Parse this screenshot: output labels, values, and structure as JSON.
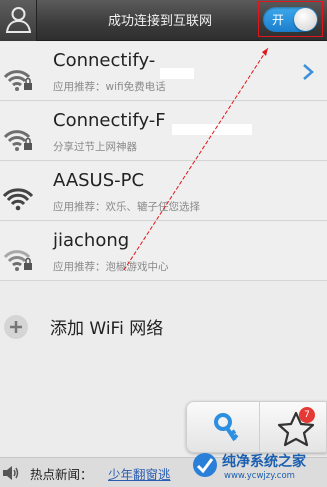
{
  "header": {
    "title": "成功连接到互联网",
    "avatar_icon": "user-icon",
    "toggle_label": "开",
    "toggle_state": "on",
    "accent_color": "#2a8fdc"
  },
  "networks": [
    {
      "name": "Connectify-",
      "subtitle": "应用推荐：wifi免费电话",
      "signal_icon": "wifi-locked-icon",
      "selected": true
    },
    {
      "name": "Connectify-F",
      "subtitle": "分享过节上网神器",
      "signal_icon": "wifi-locked-icon"
    },
    {
      "name": "AASUS-PC",
      "subtitle": "应用推荐：欢乐、辘子任您选择",
      "signal_icon": "wifi-icon"
    },
    {
      "name": "jiachong",
      "subtitle": "应用推荐：泡椒游戏中心",
      "signal_icon": "wifi-locked-icon"
    }
  ],
  "add_wifi": {
    "label": "添加 WiFi 网络",
    "icon": "plus-icon"
  },
  "floating_panel": {
    "key_icon": "key-icon",
    "star_icon": "star-icon",
    "badge_count": "7"
  },
  "news": {
    "label": "热点新闻：",
    "link_text": "少年翻窗逃",
    "icon": "speaker-icon"
  },
  "watermark": {
    "name": "纯净系统之家",
    "url": "www.ycwjzy.com"
  }
}
